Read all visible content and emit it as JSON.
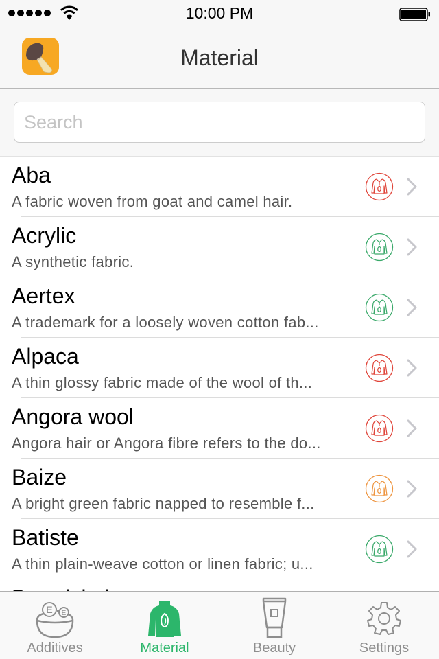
{
  "status_bar": {
    "time": "10:00 PM",
    "signal_bars": 5,
    "icons": [
      "signal-dots-icon",
      "wifi-icon",
      "battery-icon"
    ]
  },
  "nav": {
    "title": "Material",
    "logo_icon": "mushroom-app-logo"
  },
  "search": {
    "placeholder": "Search",
    "value": ""
  },
  "colors": {
    "accent": "#2cb66b",
    "status_red": "#e0453a",
    "status_green": "#3aa96a",
    "status_orange": "#ee9540",
    "chevron": "#c7c7cc"
  },
  "materials": [
    {
      "title": "Aba",
      "description": "A fabric woven from goat and camel hair.",
      "status": "red"
    },
    {
      "title": "Acrylic",
      "description": "A synthetic fabric.",
      "status": "green"
    },
    {
      "title": "Aertex",
      "description": "A trademark for a loosely woven cotton fab...",
      "status": "green"
    },
    {
      "title": "Alpaca",
      "description": "A thin glossy fabric made of the wool of th...",
      "status": "red"
    },
    {
      "title": "Angora wool",
      "description": "Angora hair or Angora fibre refers to the do...",
      "status": "red"
    },
    {
      "title": "Baize",
      "description": "A bright green fabric napped to resemble f...",
      "status": "orange"
    },
    {
      "title": "Batiste",
      "description": "A thin plain-weave cotton or linen fabric; u...",
      "status": "green"
    },
    {
      "title": "Broadcloth",
      "description": "",
      "status": ""
    }
  ],
  "tabs": [
    {
      "label": "Additives",
      "icon": "additives-bowl-icon",
      "active": false
    },
    {
      "label": "Material",
      "icon": "sweater-icon",
      "active": true
    },
    {
      "label": "Beauty",
      "icon": "cream-tube-icon",
      "active": false
    },
    {
      "label": "Settings",
      "icon": "gear-icon",
      "active": false
    }
  ]
}
